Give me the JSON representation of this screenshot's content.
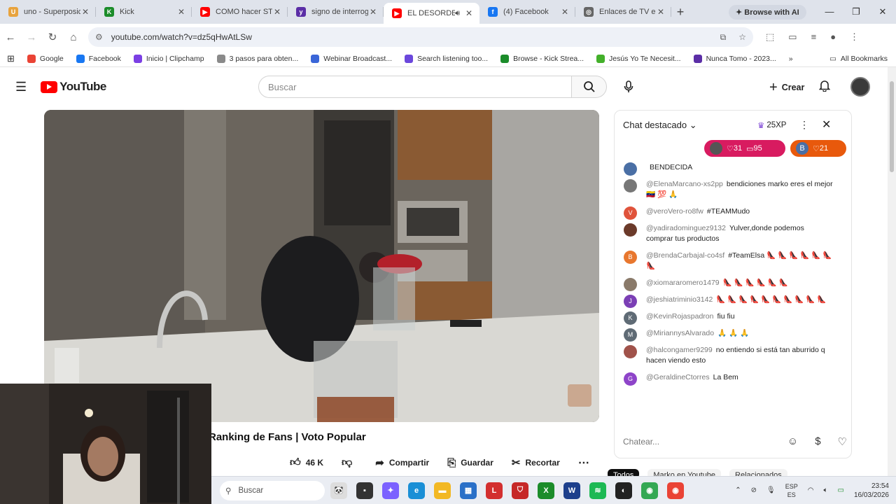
{
  "browser": {
    "tabs": [
      {
        "title": "uno - Superposic",
        "favicon_color": "#e8a33d",
        "glyph": "U",
        "active": false
      },
      {
        "title": "Kick",
        "favicon_color": "#1b8c2a",
        "glyph": "K",
        "active": false
      },
      {
        "title": "COMO hacer STR",
        "favicon_color": "#ff0000",
        "glyph": "▶",
        "active": false
      },
      {
        "title": "signo de interrog",
        "favicon_color": "#5b2ea6",
        "glyph": "y",
        "active": false
      },
      {
        "title": "EL DESORDEN",
        "favicon_color": "#ff0000",
        "glyph": "▶",
        "active": true
      },
      {
        "title": "(4) Facebook",
        "favicon_color": "#1877f2",
        "glyph": "f",
        "active": false
      },
      {
        "title": "Enlaces de TV en",
        "favicon_color": "#666666",
        "glyph": "◎",
        "active": false
      }
    ],
    "browse_ai": "Browse with AI",
    "url": "youtube.com/watch?v=dz5qHwAtLSw",
    "bookmarks": [
      {
        "label": "Google",
        "color": "#ea4335"
      },
      {
        "label": "Facebook",
        "color": "#1877f2"
      },
      {
        "label": "Inicio | Clipchamp",
        "color": "#7b3fe4"
      },
      {
        "label": "3 pasos para obten...",
        "color": "#8a8a8a"
      },
      {
        "label": "Webinar Broadcast...",
        "color": "#3a66d8"
      },
      {
        "label": "Search listening too...",
        "color": "#6b47dc"
      },
      {
        "label": "Browse - Kick Strea...",
        "color": "#1b8c2a"
      },
      {
        "label": "Jesús Yo Te Necesit...",
        "color": "#43b02a"
      },
      {
        "label": "Nunca Tomo - 2023...",
        "color": "#5b2ea6"
      }
    ],
    "all_bookmarks": "All Bookmarks"
  },
  "youtube": {
    "logo_text": "YouTube",
    "search_placeholder": "Buscar",
    "create_label": "Crear",
    "video_title": "Ranking de Fans | Voto Popular",
    "likes": "46 K",
    "share": "Compartir",
    "save": "Guardar",
    "clip": "Recortar"
  },
  "chat": {
    "header": "Chat destacado",
    "xp": "25XP",
    "pill1": {
      "likes": "31",
      "comments": "95"
    },
    "pill2": {
      "initial": "B",
      "likes": "21"
    },
    "messages": [
      {
        "author": "",
        "text": "BENDECIDA",
        "color": "#4a6fa5",
        "initial": ""
      },
      {
        "author": "@ElenaMarcano-xs2pp",
        "text": "bendiciones marko eres el mejor 🇻🇪 💯 🙏",
        "color": "#777777",
        "initial": ""
      },
      {
        "author": "@veroVero-ro8fw",
        "text": "#TEAMMudo",
        "color": "#e0533b",
        "initial": "V"
      },
      {
        "author": "@yadiradominguez9132",
        "text": "Yulver,donde podemos comprar tus productos",
        "color": "#6b3a2a",
        "initial": ""
      },
      {
        "author": "@BrendaCarbajal-co4sf",
        "text": "#TeamElsa 👠 👠 👠 👠 👠 👠 👠",
        "color": "#e8772e",
        "initial": "B"
      },
      {
        "author": "@xiomararomero1479",
        "text": "👠 👠 👠 👠 👠 👠",
        "color": "#8a7a6a",
        "initial": ""
      },
      {
        "author": "@jeshiatriminio3142",
        "text": "👠 👠 👠 👠 👠 👠 👠 👠 👠 👠",
        "color": "#7b3fb5",
        "initial": "J"
      },
      {
        "author": "@KevinRojaspadron",
        "text": "fiu fiu",
        "color": "#5f6b75",
        "initial": "K"
      },
      {
        "author": "@MiriannysAlvarado",
        "text": "🙏 🙏 🙏",
        "color": "#5f6b75",
        "initial": "M"
      },
      {
        "author": "@halcongamer9299",
        "text": "no entiendo si está tan aburrido q hacen viendo esto",
        "color": "#a0524a",
        "initial": ""
      },
      {
        "author": "@GeraldineCtorres",
        "text": "La Bem",
        "color": "#8e44c9",
        "initial": "G"
      }
    ],
    "input_placeholder": "Chatear...",
    "tabs": [
      "Todos",
      "Marko en Youtube",
      "Relacionados"
    ]
  },
  "taskbar": {
    "search": "Buscar",
    "lang_top": "ESP",
    "lang_bottom": "ES",
    "time": "23:54",
    "date": "16/03/2026"
  }
}
